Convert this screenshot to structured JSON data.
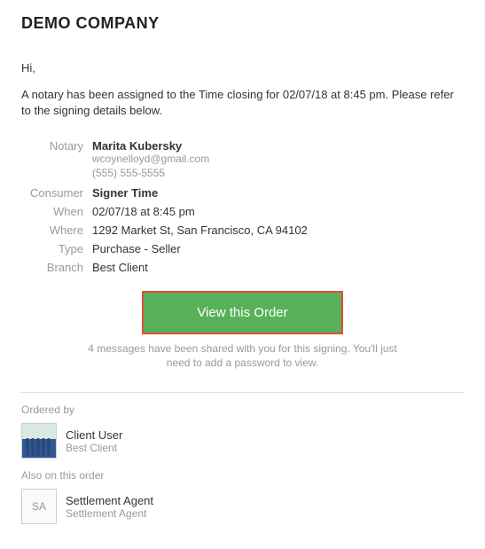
{
  "company": "DEMO COMPANY",
  "greeting": "Hi,",
  "intro": "A notary has been assigned to the Time closing for 02/07/18 at 8:45 pm. Please refer to the signing details below.",
  "details": {
    "notary_label": "Notary",
    "notary_name": "Marita Kubersky",
    "notary_email": "wcoynelloyd@gmail.com",
    "notary_phone": "(555) 555-5555",
    "consumer_label": "Consumer",
    "consumer_name": "Signer Time",
    "when_label": "When",
    "when_value": "02/07/18 at 8:45 pm",
    "where_label": "Where",
    "where_value": "1292 Market St, San Francisco, CA 94102",
    "type_label": "Type",
    "type_value": "Purchase - Seller",
    "branch_label": "Branch",
    "branch_value": "Best Client"
  },
  "cta_label": "View this Order",
  "note": "4 messages have been shared with you for this signing. You'll just need to add a password to view.",
  "ordered_by_label": "Ordered by",
  "ordered_by": {
    "name": "Client User",
    "sub": "Best Client"
  },
  "also_label": "Also on this order",
  "also": {
    "initials": "SA",
    "name": "Settlement Agent",
    "sub": "Settlement Agent"
  }
}
